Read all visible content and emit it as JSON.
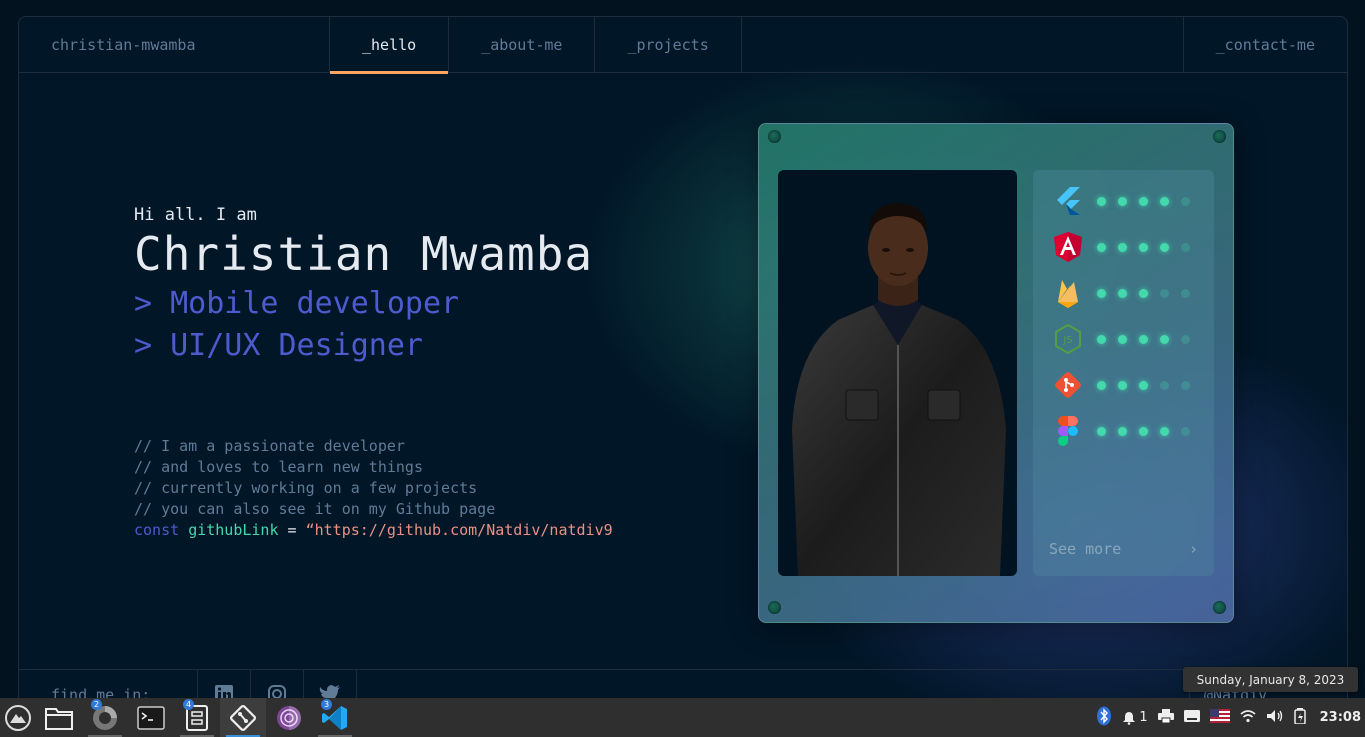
{
  "nav": {
    "brand": "christian-mwamba",
    "tabs": [
      {
        "label": "_hello"
      },
      {
        "label": "_about-me"
      },
      {
        "label": "_projects"
      }
    ],
    "contact": "_contact-me"
  },
  "hero": {
    "greeting": "Hi all. I am",
    "name": "Christian Mwamba",
    "roles": [
      "> Mobile developer",
      "> UI/UX Designer"
    ]
  },
  "code": {
    "comments": [
      "// I am a passionate developer",
      "// and loves to learn new things",
      "// currently working on a few projects",
      "// you can also see it on my Github page"
    ],
    "keyword": "const",
    "variable": "githubLink",
    "equals": "=",
    "value": "“https://github.com/Natdiv/natdiv9"
  },
  "skills": {
    "items": [
      {
        "icon": "flutter-icon",
        "level": 4
      },
      {
        "icon": "angular-icon",
        "level": 4
      },
      {
        "icon": "firebase-icon",
        "level": 3
      },
      {
        "icon": "nodejs-icon",
        "level": 4
      },
      {
        "icon": "git-icon",
        "level": 3
      },
      {
        "icon": "figma-icon",
        "level": 4
      }
    ],
    "max_level": 5,
    "see_more": "See more"
  },
  "footer": {
    "find_me": "find me in:",
    "github": "@Natdiv"
  },
  "taskbar": {
    "apps": [
      {
        "icon": "launcher-icon",
        "badge": ""
      },
      {
        "icon": "file-manager-icon",
        "badge": ""
      },
      {
        "icon": "browser-icon",
        "badge": "2"
      },
      {
        "icon": "terminal-icon",
        "badge": ""
      },
      {
        "icon": "archive-icon",
        "badge": "4"
      },
      {
        "icon": "git-client-icon",
        "badge": ""
      },
      {
        "icon": "tor-browser-icon",
        "badge": ""
      },
      {
        "icon": "vscode-icon",
        "badge": "3"
      }
    ],
    "notifications": "1",
    "time": "23:08",
    "date_tooltip": "Sunday, January 8, 2023"
  },
  "colors": {
    "accent_orange": "#fea55f",
    "accent_purple": "#4d5bce",
    "accent_green": "#43d9ad",
    "string_color": "#e99287",
    "background": "#011627"
  }
}
